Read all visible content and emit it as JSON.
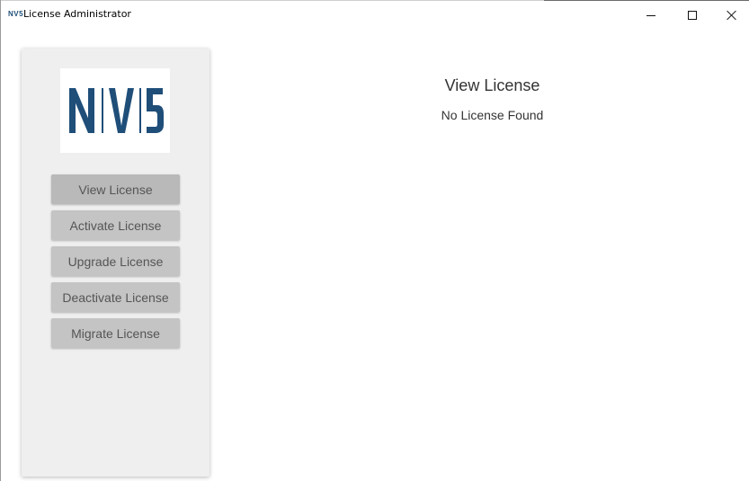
{
  "window": {
    "title": "License Administrator",
    "icon_text": "NV5",
    "controls": [
      "minimize-icon",
      "maximize-icon",
      "close-icon"
    ]
  },
  "sidebar": {
    "logo": {
      "text": "N|V|5",
      "color": "#1f4e79"
    },
    "items": [
      {
        "label": "View License",
        "active": true
      },
      {
        "label": "Activate License",
        "active": false
      },
      {
        "label": "Upgrade License",
        "active": false
      },
      {
        "label": "Deactivate License",
        "active": false
      },
      {
        "label": "Migrate License",
        "active": false
      }
    ]
  },
  "main": {
    "title": "View License",
    "status": "No License Found"
  },
  "colors": {
    "brand": "#1f4e79",
    "button": "#c4c4c4",
    "sidebar_bg": "#efefef"
  }
}
